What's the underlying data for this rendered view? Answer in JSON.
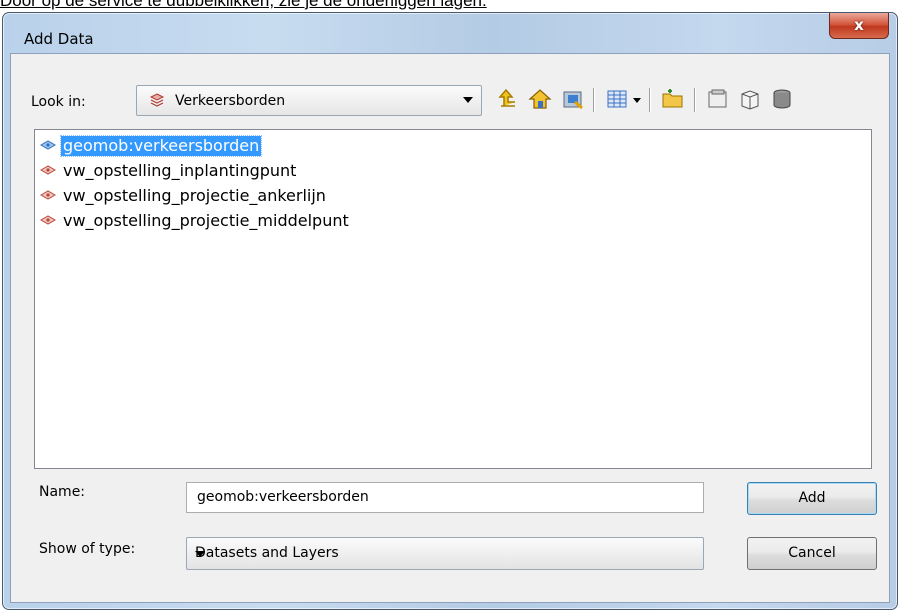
{
  "caption": "Door op de service te dubbelklikken, zie je de onderliggen lagen.",
  "window": {
    "title": "Add Data",
    "close_label": "x"
  },
  "lookin": {
    "label": "Look in:",
    "value": "Verkeersborden"
  },
  "toolbar": [
    {
      "icon": "up-one-level-icon"
    },
    {
      "icon": "home-icon"
    },
    {
      "icon": "connect-folder-icon"
    },
    {
      "icon": "list-view-icon"
    },
    {
      "icon": "view-dropdown-icon"
    },
    {
      "icon": "new-folder-icon"
    },
    {
      "icon": "catalog-icon"
    },
    {
      "icon": "new-feature-class-icon"
    },
    {
      "icon": "database-icon"
    }
  ],
  "items": [
    {
      "label": "geomob:verkeersborden",
      "selected": true,
      "icon": "service-layer-icon"
    },
    {
      "label": "vw_opstelling_inplantingpunt",
      "selected": false,
      "icon": "layer-icon"
    },
    {
      "label": "vw_opstelling_projectie_ankerlijn",
      "selected": false,
      "icon": "layer-icon"
    },
    {
      "label": "vw_opstelling_projectie_middelpunt",
      "selected": false,
      "icon": "layer-icon"
    }
  ],
  "name": {
    "label": "Name:",
    "value": "geomob:verkeersborden"
  },
  "type": {
    "label": "Show of type:",
    "value": "Datasets and Layers"
  },
  "buttons": {
    "add": "Add",
    "cancel": "Cancel"
  },
  "colors": {
    "selection": "#3399ff",
    "title_gradient": "#b9d1ea",
    "close": "#c0391f"
  }
}
